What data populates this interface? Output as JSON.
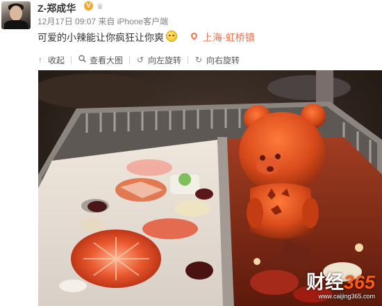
{
  "post": {
    "username": "Z-郑成华",
    "verified_badge": "V",
    "meta": "12月17日 09:07 来自 iPhone客户端",
    "text": "可爱的小辣能让你疯狂让你爽",
    "location": "上海·虹桥镇"
  },
  "toolbar": {
    "collapse": "收起",
    "view_large": "查看大图",
    "rotate_left": "向左旋转",
    "rotate_right": "向右旋转"
  },
  "watermark": {
    "brand_cn": "财经",
    "brand_num": "365",
    "url": "www.caijing365.com"
  },
  "colors": {
    "accent_orange": "#eb7350",
    "badge_gold": "#f6a623",
    "watermark_orange": "#ff5a12"
  }
}
